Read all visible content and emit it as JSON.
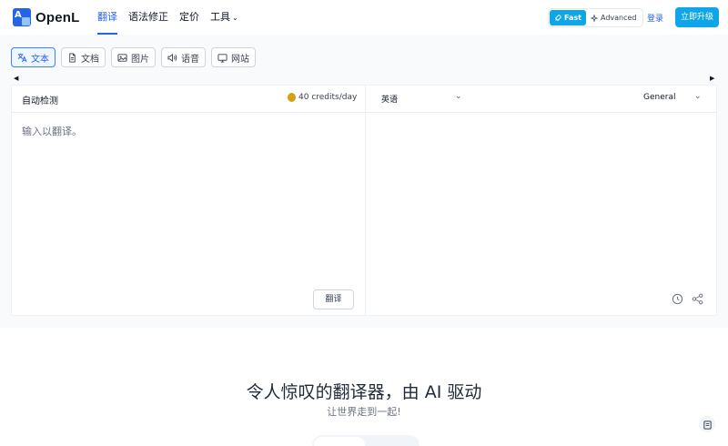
{
  "brand": {
    "name": "OpenL"
  },
  "nav": {
    "items": [
      {
        "label": "翻译",
        "active": true
      },
      {
        "label": "语法修正",
        "active": false
      },
      {
        "label": "定价",
        "active": false
      },
      {
        "label": "工具",
        "active": false
      }
    ]
  },
  "header": {
    "mode_fast": "Fast",
    "mode_advanced": "Advanced",
    "login_label": "登录",
    "upgrade_label": "立即升级"
  },
  "tabs": [
    {
      "label": "文本",
      "icon": "translate-icon",
      "active": true
    },
    {
      "label": "文档",
      "icon": "document-icon",
      "active": false
    },
    {
      "label": "图片",
      "icon": "image-icon",
      "active": false
    },
    {
      "label": "语音",
      "icon": "speaker-icon",
      "active": false
    },
    {
      "label": "网站",
      "icon": "monitor-icon",
      "active": false
    }
  ],
  "source": {
    "language": "自动检测",
    "credits": "40 credits/day",
    "placeholder": "输入以翻译。",
    "translate_label": "翻译"
  },
  "target": {
    "language": "英语",
    "style": "General"
  },
  "hero": {
    "title": "令人惊叹的翻译器，由 AI 驱动",
    "subtitle": "让世界走到一起!"
  },
  "colors": {
    "accent": "#2563eb",
    "button": "#0ea5e9",
    "band": "#f8fafc"
  }
}
